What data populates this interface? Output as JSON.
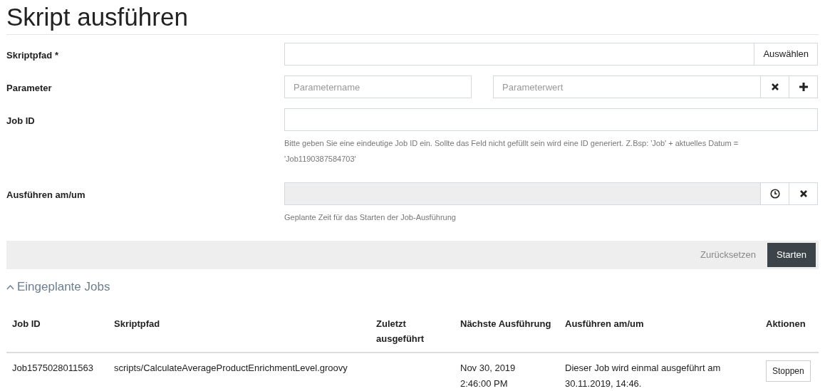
{
  "title": "Skript ausführen",
  "form": {
    "fields": [
      {
        "kind": "browse",
        "label": "Skriptpfad *",
        "button": "Auswählen"
      },
      {
        "kind": "params",
        "label": "Parameter",
        "name_placeholder": "Parametername",
        "value_placeholder": "Parameterwert"
      },
      {
        "kind": "text",
        "label": "Job ID",
        "help": "Bitte geben Sie eine eindeutige Job ID ein. Sollte das Feld nicht gefüllt sein wird eine ID generiert. Z.Bsp: 'Job' + aktuelles Datum = 'Job1190387584703'"
      },
      {
        "kind": "datetime",
        "label": "Ausführen am/um",
        "disabled": true,
        "help": "Geplante Zeit für das Starten der Job-Ausführung"
      }
    ]
  },
  "actions": [
    {
      "kind": "secondary",
      "label": "Zurücksetzen"
    },
    {
      "kind": "primary",
      "label": "Starten"
    }
  ],
  "section": {
    "title": "Eingeplante Jobs",
    "expanded": true
  },
  "table": {
    "columns": [
      "Job ID",
      "Skriptpfad",
      "Zuletzt ausgeführt",
      "Nächste Ausführung",
      "Ausführen am/um",
      "Aktionen"
    ],
    "rows": [
      {
        "job_id": "Job1575028011563",
        "script": "scripts/CalculateAverageProductEnrichmentLevel.groovy",
        "next_run": "Nov 30, 2019 2:46:00 PM",
        "schedule": "Dieser Job wird einmal ausgeführt am 30.11.2019, 14:46.",
        "action": "Stoppen"
      }
    ]
  }
}
